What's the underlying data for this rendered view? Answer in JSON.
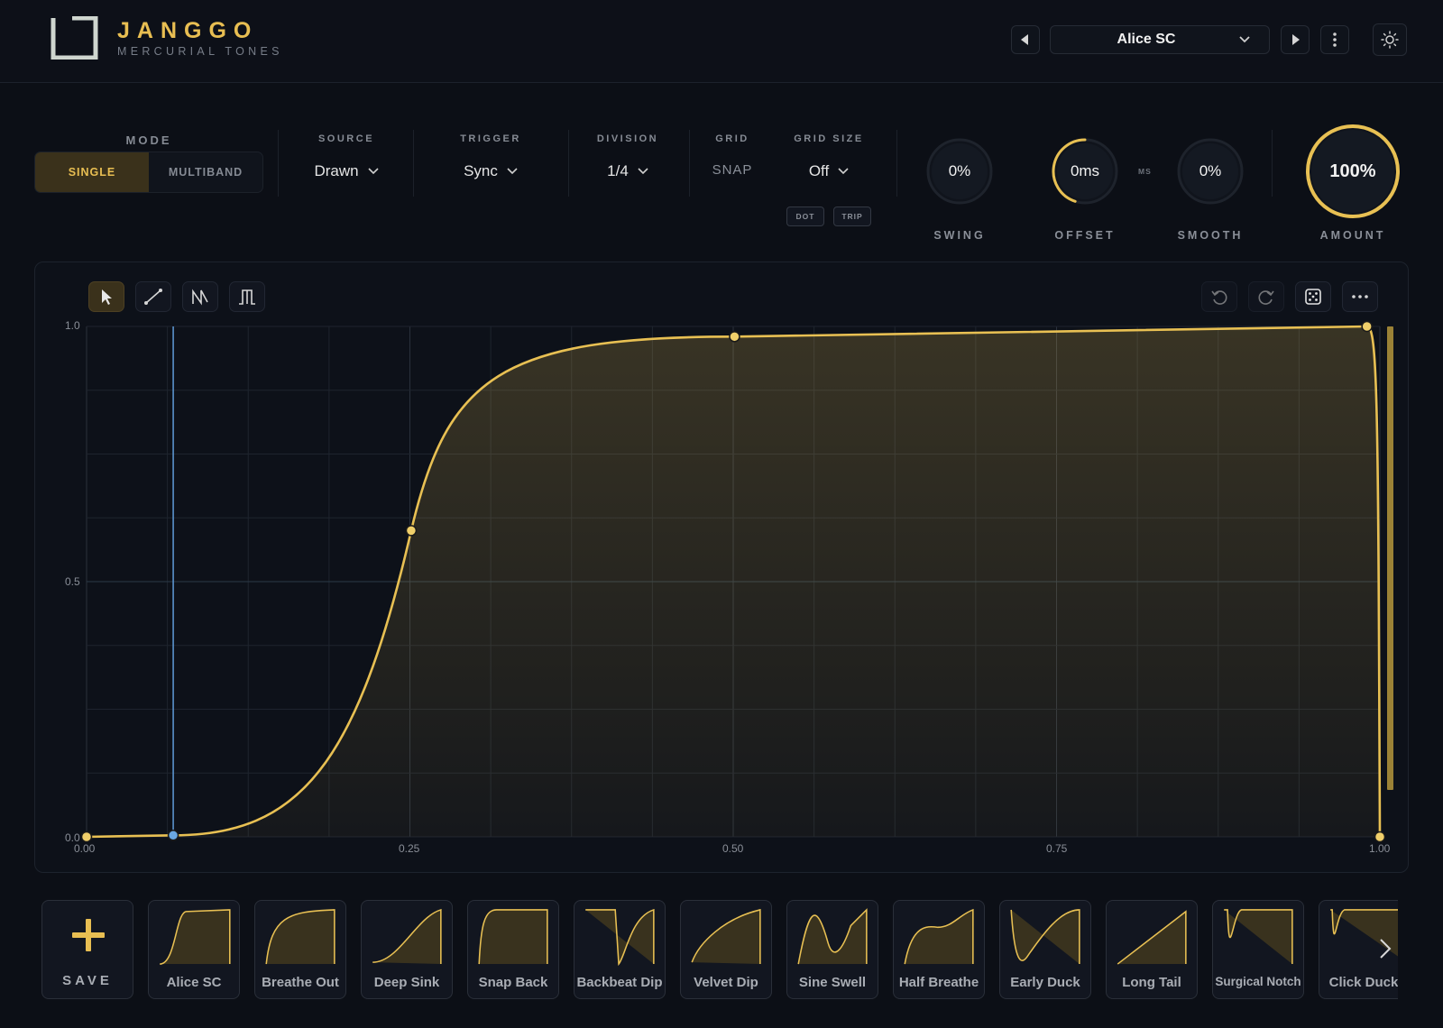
{
  "header": {
    "brand": "JANGGO",
    "tagline": "MERCURIAL TONES",
    "preset_name": "Alice SC",
    "icons": {
      "prev": "caret-left-icon",
      "next": "caret-right-icon",
      "menu": "kebab-menu-icon",
      "theme": "sun-icon",
      "dropdown": "chevron-down-icon"
    }
  },
  "controls": {
    "mode": {
      "label": "MODE",
      "options": [
        "SINGLE",
        "MULTIBAND"
      ],
      "selected": "SINGLE"
    },
    "source": {
      "label": "SOURCE",
      "value": "Drawn"
    },
    "trigger": {
      "label": "TRIGGER",
      "value": "Sync"
    },
    "division": {
      "label": "DIVISION",
      "value": "1/4"
    },
    "grid": {
      "label": "GRID",
      "value": "SNAP"
    },
    "grid_size": {
      "label": "GRID SIZE",
      "value": "Off",
      "dot": "DOT",
      "trip": "TRIP"
    },
    "swing": {
      "label": "SWING",
      "value": "0%",
      "level": 0
    },
    "offset": {
      "label": "OFFSET",
      "value": "0ms",
      "unit": "MS",
      "level": 0.45
    },
    "smooth": {
      "label": "SMOOTH",
      "value": "0%",
      "level": 0
    },
    "amount": {
      "label": "AMOUNT",
      "value": "100%",
      "level": 1.0
    }
  },
  "editor": {
    "tools": [
      "pointer-tool-icon",
      "line-tool-icon",
      "ramp-tool-icon",
      "square-tool-icon"
    ],
    "right_tools": [
      "undo-icon",
      "redo-icon",
      "dice-icon",
      "more-icon"
    ],
    "y_labels": [
      "1.0",
      "0.5",
      "0.0"
    ],
    "x_labels": [
      "0.00",
      "0.25",
      "0.50",
      "0.75",
      "1.00"
    ],
    "colors": {
      "curve": "#e8c053",
      "playhead": "#5f9bd8",
      "grid": "#1e242e"
    },
    "playhead_x": 0.067,
    "points": [
      {
        "x": 0.0,
        "y": 0.0
      },
      {
        "x": 0.067,
        "y": 0.003
      },
      {
        "x": 0.251,
        "y": 0.6
      },
      {
        "x": 0.501,
        "y": 0.98
      },
      {
        "x": 0.99,
        "y": 1.0
      },
      {
        "x": 1.0,
        "y": 0.0
      }
    ]
  },
  "presets": {
    "save_label": "SAVE",
    "items": [
      {
        "name": "Alice SC",
        "shape": "alice"
      },
      {
        "name": "Breathe Out",
        "shape": "breathe"
      },
      {
        "name": "Deep Sink",
        "shape": "deepsink"
      },
      {
        "name": "Snap Back",
        "shape": "snapback"
      },
      {
        "name": "Backbeat Dip",
        "shape": "backbeat"
      },
      {
        "name": "Velvet Dip",
        "shape": "velvet"
      },
      {
        "name": "Sine Swell",
        "shape": "sine"
      },
      {
        "name": "Half Breathe",
        "shape": "half"
      },
      {
        "name": "Early Duck",
        "shape": "early"
      },
      {
        "name": "Long Tail",
        "shape": "longtail"
      },
      {
        "name": "Surgical Notch",
        "shape": "notch"
      },
      {
        "name": "Click Duck",
        "shape": "click"
      }
    ]
  }
}
